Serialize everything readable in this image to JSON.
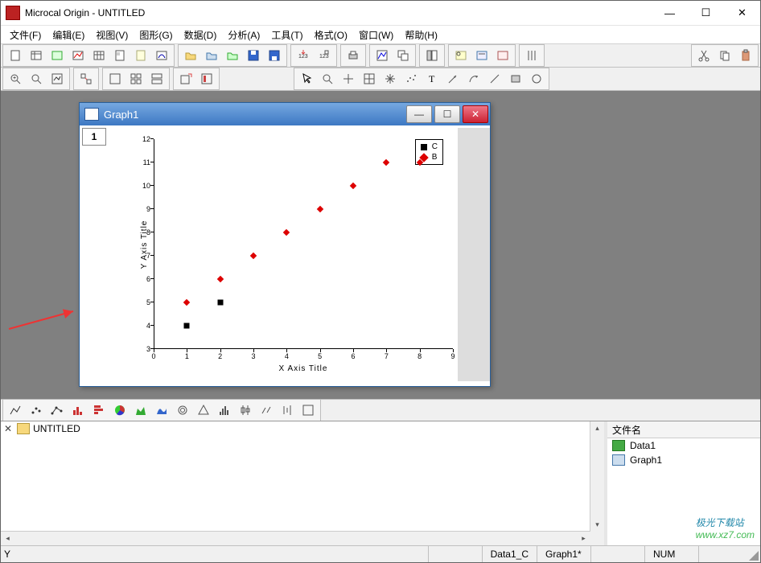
{
  "app": {
    "title": "Microcal Origin - UNTITLED"
  },
  "menu": {
    "items": [
      "文件(F)",
      "编辑(E)",
      "视图(V)",
      "图形(G)",
      "数据(D)",
      "分析(A)",
      "工具(T)",
      "格式(O)",
      "窗口(W)",
      "帮助(H)"
    ]
  },
  "graph_window": {
    "title": "Graph1",
    "page_tab": "1"
  },
  "legend": {
    "c_label": "C",
    "b_label": "B"
  },
  "axes": {
    "x_title": "X Axis Title",
    "y_title": "Y Axis Title"
  },
  "project": {
    "name": "UNTITLED"
  },
  "file_list": {
    "header": "文件名",
    "items": [
      {
        "name": "Data1",
        "type": "wks"
      },
      {
        "name": "Graph1",
        "type": "grf"
      }
    ]
  },
  "statusbar": {
    "left": "Y",
    "cells": [
      "",
      "Data1_C",
      "Graph1*",
      "",
      "NUM",
      ""
    ]
  },
  "watermark": {
    "text": "极光下载站",
    "url": "www.xz7.com"
  },
  "chart_data": {
    "type": "scatter",
    "x_title": "X Axis Title",
    "y_title": "Y Axis Title",
    "xlim": [
      0,
      9
    ],
    "ylim": [
      3,
      12
    ],
    "xticks": [
      0,
      1,
      2,
      3,
      4,
      5,
      6,
      7,
      8,
      9
    ],
    "yticks": [
      3,
      4,
      5,
      6,
      7,
      8,
      9,
      10,
      11,
      12
    ],
    "series": [
      {
        "name": "C",
        "marker": "square",
        "color": "#000000",
        "x": [
          1,
          2
        ],
        "y": [
          4,
          5
        ]
      },
      {
        "name": "B",
        "marker": "diamond",
        "color": "#d00000",
        "x": [
          1,
          2,
          3,
          4,
          5,
          6,
          7,
          8
        ],
        "y": [
          5,
          6,
          7,
          8,
          9,
          10,
          11,
          11
        ]
      }
    ]
  }
}
